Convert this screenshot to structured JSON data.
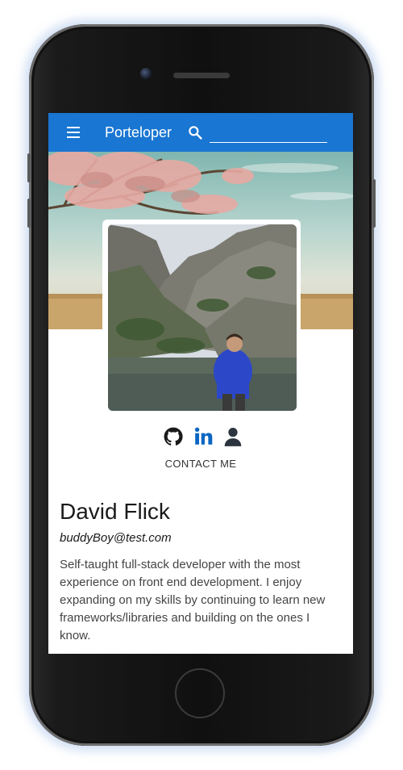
{
  "appbar": {
    "title": "Porteloper",
    "search": {
      "value": "",
      "placeholder": ""
    },
    "menu_icon": "menu-icon",
    "search_icon": "search-icon"
  },
  "profile": {
    "name": "David Flick",
    "email": "buddyBoy@test.com",
    "bio": "Self-taught full-stack developer with the most experience on front end development. I enjoy expanding on my skills by continuing to learn new frameworks/libraries and building on the ones I know.",
    "contact_label": "CONTACT ME"
  },
  "social": [
    {
      "icon": "github-icon",
      "color": "#1a1a1a"
    },
    {
      "icon": "linkedin-icon",
      "color": "#0a66c2"
    },
    {
      "icon": "person-icon",
      "color": "#2c3440"
    }
  ],
  "colors": {
    "appbar": "#1976d2"
  }
}
